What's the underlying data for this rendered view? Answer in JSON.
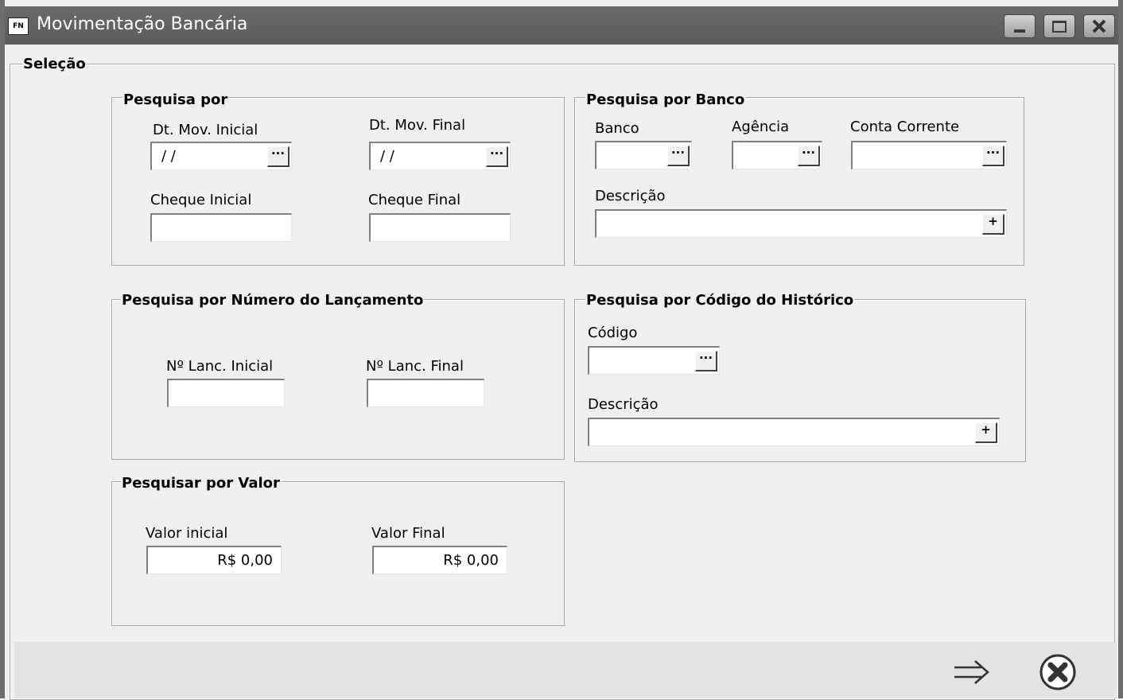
{
  "window": {
    "title": "Movimentação Bancária",
    "app_icon": "FN"
  },
  "selecao": {
    "legend": "Seleção"
  },
  "pesquisa_por": {
    "legend": "Pesquisa por",
    "dt_inicial_label": "Dt. Mov. Inicial",
    "dt_inicial_value": "/ /",
    "dt_final_label": "Dt. Mov. Final",
    "dt_final_value": "/ /",
    "cheque_inicial_label": "Cheque Inicial",
    "cheque_final_label": "Cheque Final"
  },
  "pesquisa_banco": {
    "legend": "Pesquisa por Banco",
    "banco_label": "Banco",
    "agencia_label": "Agência",
    "conta_label": "Conta Corrente",
    "descricao_label": "Descrição"
  },
  "pesquisa_numero": {
    "legend": "Pesquisa por Número do Lançamento",
    "inicial_label": "Nº Lanc. Inicial",
    "final_label": "Nº Lanc. Final"
  },
  "pesquisa_historico": {
    "legend": "Pesquisa por Código do Histórico",
    "codigo_label": "Código",
    "descricao_label": "Descrição"
  },
  "pesquisa_valor": {
    "legend": "Pesquisar por Valor",
    "inicial_label": "Valor inicial",
    "inicial_value": "R$ 0,00",
    "final_label": "Valor Final",
    "final_value": "R$ 0,00"
  },
  "buttons": {
    "ellipsis": "···",
    "plus": "+"
  },
  "icons": {
    "confirm": "arrow-right-icon",
    "cancel": "close-circle-icon"
  }
}
